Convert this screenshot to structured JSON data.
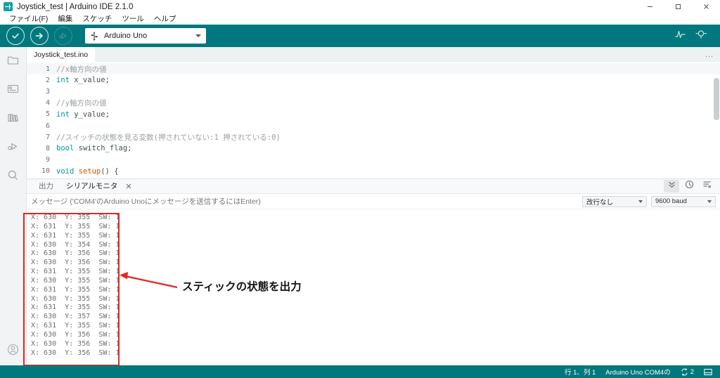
{
  "window": {
    "title": "Joystick_test | Arduino IDE 2.1.0",
    "app_icon": "arduino-icon",
    "controls": {
      "minimize": "minimize-icon",
      "maximize": "maximize-icon",
      "close": "close-icon"
    }
  },
  "menubar": {
    "items": [
      {
        "label": "ファイル(F)",
        "name": "menu-file"
      },
      {
        "label": "編集",
        "name": "menu-edit"
      },
      {
        "label": "スケッチ",
        "name": "menu-sketch"
      },
      {
        "label": "ツール",
        "name": "menu-tools"
      },
      {
        "label": "ヘルプ",
        "name": "menu-help"
      }
    ]
  },
  "toolbar": {
    "verify_label": "verify-icon",
    "upload_label": "upload-icon",
    "debug_label": "debug-icon",
    "board_selector": {
      "value": "Arduino Uno",
      "icon": "usb-icon"
    },
    "serial_plotter_icon": "serial-plotter-icon",
    "serial_monitor_icon": "serial-monitor-icon"
  },
  "activity_bar": {
    "items": [
      {
        "name": "sketchbook-icon",
        "label": "Sketchbook"
      },
      {
        "name": "boards-manager-icon",
        "label": "Boards Manager"
      },
      {
        "name": "library-manager-icon",
        "label": "Library Manager"
      },
      {
        "name": "debug-icon",
        "label": "Debug"
      },
      {
        "name": "search-icon",
        "label": "Search"
      }
    ],
    "account_icon": "account-icon"
  },
  "editor": {
    "tab_label": "Joystick_test.ino",
    "more_label": "...",
    "lines": [
      {
        "no": "1",
        "segments": [
          {
            "cls": "cm",
            "t": "//x軸方向の値"
          }
        ]
      },
      {
        "no": "2",
        "segments": [
          {
            "cls": "kw",
            "t": "int"
          },
          {
            "cls": "pn",
            "t": " x_value;"
          }
        ]
      },
      {
        "no": "3",
        "segments": [
          {
            "cls": "pn",
            "t": ""
          }
        ]
      },
      {
        "no": "4",
        "segments": [
          {
            "cls": "cm",
            "t": "//y軸方向の値"
          }
        ]
      },
      {
        "no": "5",
        "segments": [
          {
            "cls": "kw",
            "t": "int"
          },
          {
            "cls": "pn",
            "t": " y_value;"
          }
        ]
      },
      {
        "no": "6",
        "segments": [
          {
            "cls": "pn",
            "t": ""
          }
        ]
      },
      {
        "no": "7",
        "segments": [
          {
            "cls": "cm",
            "t": "//スイッチの状態を見る変数(押されていない:1 押されている:0)"
          }
        ]
      },
      {
        "no": "8",
        "segments": [
          {
            "cls": "kw",
            "t": "bool"
          },
          {
            "cls": "pn",
            "t": " switch_flag;"
          }
        ]
      },
      {
        "no": "9",
        "segments": [
          {
            "cls": "pn",
            "t": ""
          }
        ]
      },
      {
        "no": "10",
        "segments": [
          {
            "cls": "kw",
            "t": "void"
          },
          {
            "cls": "pn",
            "t": " "
          },
          {
            "cls": "fn",
            "t": "setup"
          },
          {
            "cls": "pn",
            "t": "() {"
          }
        ]
      },
      {
        "no": "11",
        "segments": [
          {
            "cls": "pn",
            "t": ""
          }
        ]
      }
    ]
  },
  "panel": {
    "tabs": [
      {
        "label": "出力",
        "name": "tab-output",
        "active": false
      },
      {
        "label": "シリアルモニタ",
        "name": "tab-serial-monitor",
        "active": true
      }
    ],
    "close_glyph": "✕",
    "right_icons": [
      {
        "name": "scroll-to-bottom-icon",
        "boxed": true
      },
      {
        "name": "timestamp-icon",
        "boxed": false
      },
      {
        "name": "clear-output-icon",
        "boxed": false
      }
    ],
    "message_input": {
      "placeholder": "メッセージ ('COM4'のArduino Unoにメッセージを送信するにはEnter)",
      "value": ""
    },
    "line_ending_select": {
      "value": "改行なし"
    },
    "baud_select": {
      "value": "9600 baud"
    },
    "console_lines": [
      "X: 630  Y: 355  SW: 1",
      "X: 631  Y: 355  SW: 1",
      "X: 631  Y: 355  SW: 1",
      "X: 630  Y: 354  SW: 1",
      "X: 630  Y: 356  SW: 1",
      "X: 630  Y: 356  SW: 1",
      "X: 631  Y: 355  SW: 1",
      "X: 630  Y: 355  SW: 1",
      "X: 631  Y: 355  SW: 1",
      "X: 630  Y: 355  SW: 1",
      "X: 631  Y: 355  SW: 1",
      "X: 630  Y: 357  SW: 1",
      "X: 631  Y: 355  SW: 1",
      "X: 630  Y: 356  SW: 1",
      "X: 630  Y: 356  SW: 1",
      "X: 630  Y: 356  SW: 1"
    ]
  },
  "annotation": {
    "label": "スティックの状態を出力",
    "color": "#e8251f"
  },
  "statusbar": {
    "cursor_position": "行 1、列 1",
    "board_port": "Arduino Uno COM4の",
    "notification_count": "2",
    "notification_icon": "notification-icon",
    "layout_icon": "toggle-panel-icon"
  },
  "colors": {
    "accent_teal": "#00787d",
    "toolbar_teal": "#00787d",
    "annotation_red": "#e8251f",
    "keyword": "#00979c",
    "comment": "#9aa0a4",
    "function": "#d35400"
  }
}
